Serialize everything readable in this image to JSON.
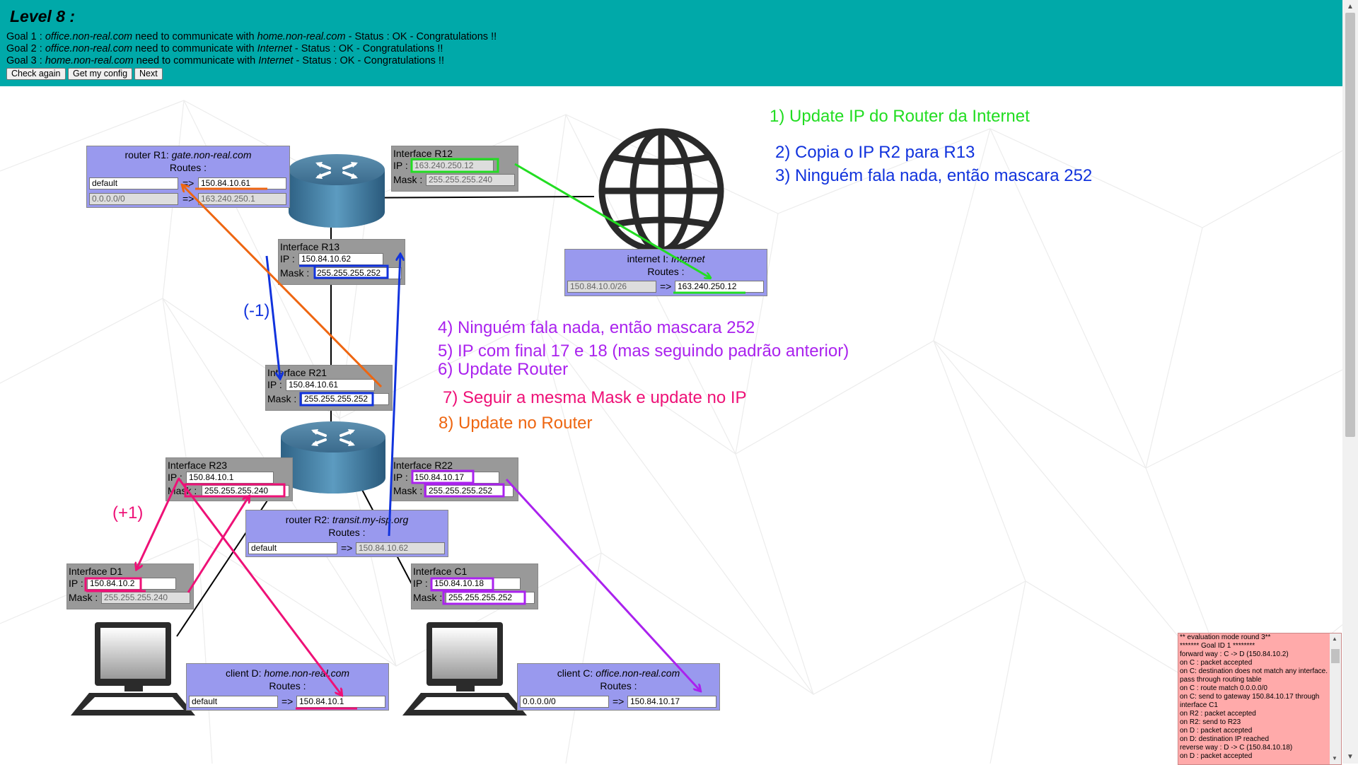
{
  "header": {
    "title": "Level 8 :",
    "goals": [
      {
        "prefix": "Goal 1 : ",
        "a": "office.non-real.com",
        "mid": " need to communicate with ",
        "b": "home.non-real.com",
        "status": " - Status : OK - Congratulations !!"
      },
      {
        "prefix": "Goal 2 : ",
        "a": "office.non-real.com",
        "mid": " need to communicate with ",
        "b": "Internet",
        "status": " - Status : OK - Congratulations !!"
      },
      {
        "prefix": "Goal 3 : ",
        "a": "home.non-real.com",
        "mid": " need to communicate with ",
        "b": "Internet",
        "status": " - Status : OK - Congratulations !!"
      }
    ],
    "buttons": {
      "check": "Check again",
      "config": "Get my config",
      "next": "Next"
    }
  },
  "routes_label": "Routes :",
  "arrow": "=>",
  "ip_label": "IP :",
  "mask_label": "Mask :",
  "router_r1": {
    "prefix": "router R1: ",
    "name": "gate.non-real.com",
    "routes": [
      {
        "dest": "default",
        "gw": "150.84.10.61"
      },
      {
        "dest": "0.0.0.0/0",
        "gw": "163.240.250.1"
      }
    ]
  },
  "iface_r12": {
    "title": "Interface R12",
    "ip": "163.240.250.12",
    "mask": "255.255.255.240"
  },
  "iface_r13": {
    "title": "Interface R13",
    "ip": "150.84.10.62",
    "mask": "255.255.255.252"
  },
  "internet": {
    "prefix": "internet I: ",
    "name": "Internet",
    "route": {
      "dest": "150.84.10.0/26",
      "gw": "163.240.250.12"
    }
  },
  "iface_r21": {
    "title": "Interface R21",
    "ip": "150.84.10.61",
    "mask": "255.255.255.252"
  },
  "iface_r23": {
    "title": "Interface R23",
    "ip": "150.84.10.1",
    "mask": "255.255.255.240"
  },
  "iface_r22": {
    "title": "Interface R22",
    "ip": "150.84.10.17",
    "mask": "255.255.255.252"
  },
  "router_r2": {
    "prefix": "router R2: ",
    "name": "transit.my-isp.org",
    "route": {
      "dest": "default",
      "gw": "150.84.10.62"
    }
  },
  "iface_d1": {
    "title": "Interface D1",
    "ip": "150.84.10.2",
    "mask": "255.255.255.240"
  },
  "iface_c1": {
    "title": "Interface C1",
    "ip": "150.84.10.18",
    "mask": "255.255.255.252"
  },
  "client_d": {
    "prefix": "client D: ",
    "name": "home.non-real.com",
    "route": {
      "dest": "default",
      "gw": "150.84.10.1"
    }
  },
  "client_c": {
    "prefix": "client C: ",
    "name": "office.non-real.com",
    "route": {
      "dest": "0.0.0.0/0",
      "gw": "150.84.10.17"
    }
  },
  "annotations": {
    "a1": "1) Update IP do Router da Internet",
    "a2": "2) Copia o IP R2 para R13",
    "a3": "3) Ninguém fala nada, então mascara 252",
    "a4": "4) Ninguém fala nada, então mascara 252",
    "a5": "5) IP com final 17 e 18 (mas seguindo padrão anterior)",
    "a6": "6) Update Router",
    "a7": "7) Seguir a mesma Mask e update no IP",
    "a8": "8) Update no Router",
    "minus": "(-1)",
    "plus": "(+1)"
  },
  "colors": {
    "green": "#22dd22",
    "blue": "#1133dd",
    "purple": "#aa22ee",
    "pink": "#ee1177",
    "orange": "#ee6611",
    "header": "#00a9a9",
    "box_purple": "#9999ee",
    "box_gray": "#999999"
  },
  "log": [
    "** evaluation mode round 3**",
    "******* Goal ID 1 ********",
    "forward way : C -> D (150.84.10.2)",
    "on C : packet accepted",
    "on C: destination does not match any interface. pass through routing table",
    "on C : route match 0.0.0.0/0",
    "on C: send to gateway 150.84.10.17 through interface C1",
    "on R2 : packet accepted",
    "on R2: send to R23",
    "on D : packet accepted",
    "on D: destination IP reached",
    "reverse way : D -> C (150.84.10.18)",
    "on D : packet accepted"
  ]
}
